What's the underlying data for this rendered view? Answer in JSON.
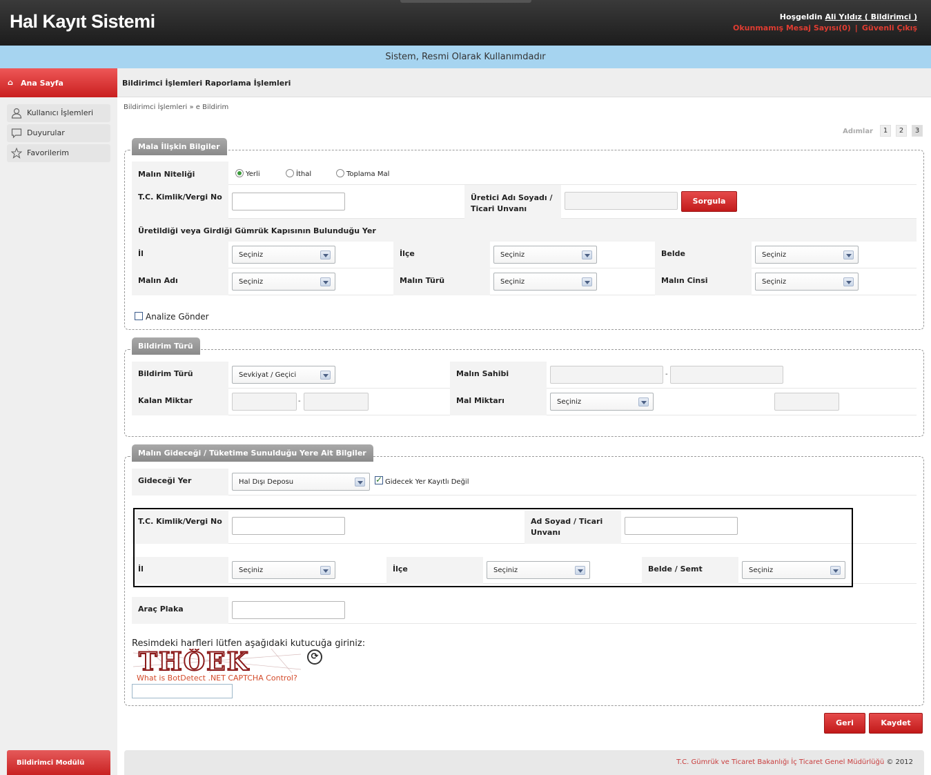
{
  "header": {
    "title": "Hal Kayıt Sistemi",
    "welcome_prefix": "Hoşgeldin",
    "user": "Ali Yıldız ( Bildirimci )",
    "unread": "Okunmamış Mesaj Sayısı(0)",
    "separator": "|",
    "logout": "Güvenli Çıkış"
  },
  "banner": "Sistem, Resmi Olarak Kullanımdadır",
  "sidebar": {
    "home": "Ana Sayfa",
    "items": [
      {
        "label": "Kullanıcı İşlemleri",
        "icon": "user-icon"
      },
      {
        "label": "Duyurular",
        "icon": "speech-bubble-icon"
      },
      {
        "label": "Favorilerim",
        "icon": "star-icon"
      }
    ],
    "module": "Bildirimci Modülü"
  },
  "topnav": [
    "Bildirimci İşlemleri",
    "Raporlama İşlemleri"
  ],
  "breadcrumb": "Bildirimci İşlemleri » e Bildirim",
  "steps": {
    "label": "Adımlar",
    "items": [
      "1",
      "2",
      "3"
    ],
    "active": "3"
  },
  "section1": {
    "legend": "Mala İlişkin Bilgiler",
    "malin_niteligi": "Malın Niteliği",
    "radios": [
      {
        "label": "Yerli",
        "checked": true
      },
      {
        "label": "İthal",
        "checked": false
      },
      {
        "label": "Toplama Mal",
        "checked": false
      }
    ],
    "tc_label": "T.C. Kimlik/Vergi No",
    "uretici_label_1": "Üretici Adı Soyadı /",
    "uretici_label_2": "Ticari Unvanı",
    "sorgula": "Sorgula",
    "gumruk_label": "Üretildiği veya Girdiği Gümrük Kapısının Bulunduğu Yer",
    "il": "İl",
    "ilce": "İlçe",
    "belde": "Belde",
    "malin_adi": "Malın Adı",
    "malin_turu": "Malın Türü",
    "malin_cinsi": "Malın Cinsi",
    "select_default": "Seçiniz",
    "analize": "Analize Gönder"
  },
  "section2": {
    "legend": "Bildirim Türü",
    "bildirim_turu": "Bildirim Türü",
    "bildirim_value": "Sevkiyat / Geçici",
    "malin_sahibi": "Malın Sahibi",
    "kalan_miktar": "Kalan Miktar",
    "mal_miktari": "Mal Miktarı",
    "select_default": "Seçiniz",
    "dash": "-"
  },
  "section3": {
    "legend": "Malın Gideceği / Tüketime Sunulduğu Yere Ait Bilgiler",
    "gidecegi_yer": "Gideceği Yer",
    "gidecegi_value": "Hal Dışı Deposu",
    "kayitli_degil": "Gidecek Yer Kayıtlı Değil",
    "tc_label": "T.C. Kimlik/Vergi No",
    "ad_soyad_1": "Ad Soyad / Ticari",
    "ad_soyad_2": "Unvanı",
    "il": "İl",
    "ilce": "İlçe",
    "belde_semt": "Belde / Semt",
    "select_default": "Seçiniz",
    "arac_plaka": "Araç Plaka",
    "captcha_text": "Resimdeki harfleri lütfen aşağıdaki kutucuğa giriniz:",
    "captcha_code": "THÖEK",
    "captcha_link": "What is BotDetect .NET CAPTCHA Control?"
  },
  "buttons": {
    "back": "Geri",
    "save": "Kaydet"
  },
  "footer": {
    "org": "T.C. Gümrük ve Ticaret Bakanlığı İç Ticaret Genel Müdürlüğü",
    "copy": "© 2012"
  }
}
